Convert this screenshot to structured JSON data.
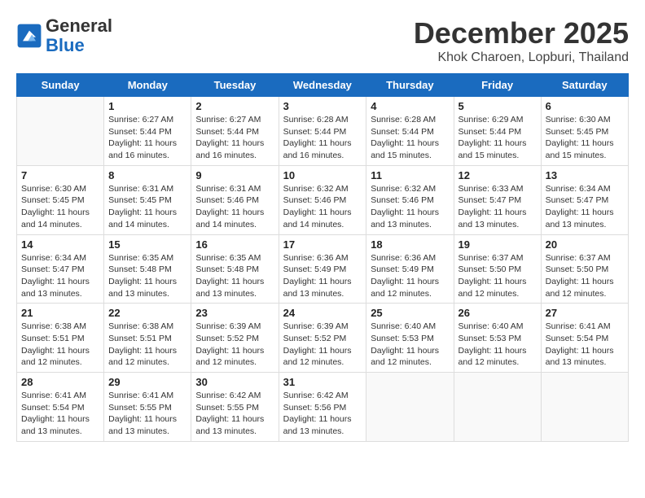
{
  "header": {
    "logo_line1": "General",
    "logo_line2": "Blue",
    "month_title": "December 2025",
    "location": "Khok Charoen, Lopburi, Thailand"
  },
  "days_of_week": [
    "Sunday",
    "Monday",
    "Tuesday",
    "Wednesday",
    "Thursday",
    "Friday",
    "Saturday"
  ],
  "weeks": [
    [
      {
        "day": "",
        "info": ""
      },
      {
        "day": "1",
        "info": "Sunrise: 6:27 AM\nSunset: 5:44 PM\nDaylight: 11 hours and 16 minutes."
      },
      {
        "day": "2",
        "info": "Sunrise: 6:27 AM\nSunset: 5:44 PM\nDaylight: 11 hours and 16 minutes."
      },
      {
        "day": "3",
        "info": "Sunrise: 6:28 AM\nSunset: 5:44 PM\nDaylight: 11 hours and 16 minutes."
      },
      {
        "day": "4",
        "info": "Sunrise: 6:28 AM\nSunset: 5:44 PM\nDaylight: 11 hours and 15 minutes."
      },
      {
        "day": "5",
        "info": "Sunrise: 6:29 AM\nSunset: 5:44 PM\nDaylight: 11 hours and 15 minutes."
      },
      {
        "day": "6",
        "info": "Sunrise: 6:30 AM\nSunset: 5:45 PM\nDaylight: 11 hours and 15 minutes."
      }
    ],
    [
      {
        "day": "7",
        "info": "Sunrise: 6:30 AM\nSunset: 5:45 PM\nDaylight: 11 hours and 14 minutes."
      },
      {
        "day": "8",
        "info": "Sunrise: 6:31 AM\nSunset: 5:45 PM\nDaylight: 11 hours and 14 minutes."
      },
      {
        "day": "9",
        "info": "Sunrise: 6:31 AM\nSunset: 5:46 PM\nDaylight: 11 hours and 14 minutes."
      },
      {
        "day": "10",
        "info": "Sunrise: 6:32 AM\nSunset: 5:46 PM\nDaylight: 11 hours and 14 minutes."
      },
      {
        "day": "11",
        "info": "Sunrise: 6:32 AM\nSunset: 5:46 PM\nDaylight: 11 hours and 13 minutes."
      },
      {
        "day": "12",
        "info": "Sunrise: 6:33 AM\nSunset: 5:47 PM\nDaylight: 11 hours and 13 minutes."
      },
      {
        "day": "13",
        "info": "Sunrise: 6:34 AM\nSunset: 5:47 PM\nDaylight: 11 hours and 13 minutes."
      }
    ],
    [
      {
        "day": "14",
        "info": "Sunrise: 6:34 AM\nSunset: 5:47 PM\nDaylight: 11 hours and 13 minutes."
      },
      {
        "day": "15",
        "info": "Sunrise: 6:35 AM\nSunset: 5:48 PM\nDaylight: 11 hours and 13 minutes."
      },
      {
        "day": "16",
        "info": "Sunrise: 6:35 AM\nSunset: 5:48 PM\nDaylight: 11 hours and 13 minutes."
      },
      {
        "day": "17",
        "info": "Sunrise: 6:36 AM\nSunset: 5:49 PM\nDaylight: 11 hours and 13 minutes."
      },
      {
        "day": "18",
        "info": "Sunrise: 6:36 AM\nSunset: 5:49 PM\nDaylight: 11 hours and 12 minutes."
      },
      {
        "day": "19",
        "info": "Sunrise: 6:37 AM\nSunset: 5:50 PM\nDaylight: 11 hours and 12 minutes."
      },
      {
        "day": "20",
        "info": "Sunrise: 6:37 AM\nSunset: 5:50 PM\nDaylight: 11 hours and 12 minutes."
      }
    ],
    [
      {
        "day": "21",
        "info": "Sunrise: 6:38 AM\nSunset: 5:51 PM\nDaylight: 11 hours and 12 minutes."
      },
      {
        "day": "22",
        "info": "Sunrise: 6:38 AM\nSunset: 5:51 PM\nDaylight: 11 hours and 12 minutes."
      },
      {
        "day": "23",
        "info": "Sunrise: 6:39 AM\nSunset: 5:52 PM\nDaylight: 11 hours and 12 minutes."
      },
      {
        "day": "24",
        "info": "Sunrise: 6:39 AM\nSunset: 5:52 PM\nDaylight: 11 hours and 12 minutes."
      },
      {
        "day": "25",
        "info": "Sunrise: 6:40 AM\nSunset: 5:53 PM\nDaylight: 11 hours and 12 minutes."
      },
      {
        "day": "26",
        "info": "Sunrise: 6:40 AM\nSunset: 5:53 PM\nDaylight: 11 hours and 12 minutes."
      },
      {
        "day": "27",
        "info": "Sunrise: 6:41 AM\nSunset: 5:54 PM\nDaylight: 11 hours and 13 minutes."
      }
    ],
    [
      {
        "day": "28",
        "info": "Sunrise: 6:41 AM\nSunset: 5:54 PM\nDaylight: 11 hours and 13 minutes."
      },
      {
        "day": "29",
        "info": "Sunrise: 6:41 AM\nSunset: 5:55 PM\nDaylight: 11 hours and 13 minutes."
      },
      {
        "day": "30",
        "info": "Sunrise: 6:42 AM\nSunset: 5:55 PM\nDaylight: 11 hours and 13 minutes."
      },
      {
        "day": "31",
        "info": "Sunrise: 6:42 AM\nSunset: 5:56 PM\nDaylight: 11 hours and 13 minutes."
      },
      {
        "day": "",
        "info": ""
      },
      {
        "day": "",
        "info": ""
      },
      {
        "day": "",
        "info": ""
      }
    ]
  ]
}
